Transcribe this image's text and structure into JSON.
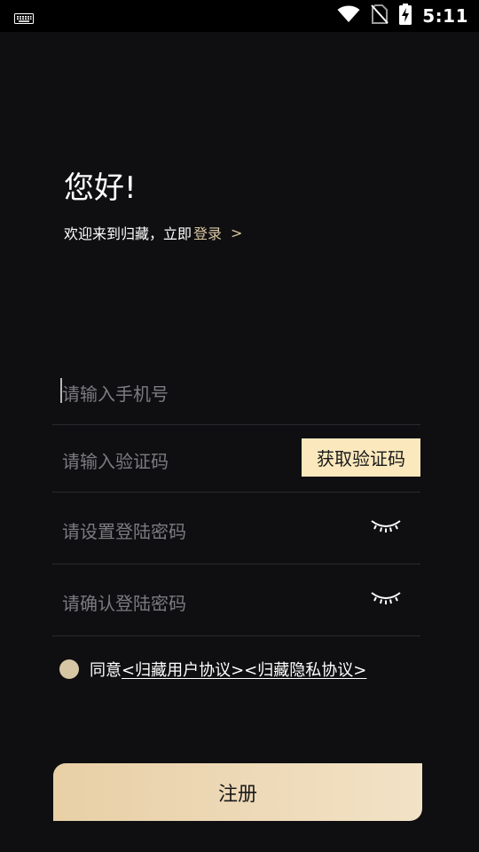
{
  "status_bar": {
    "time": "5:11",
    "icons": [
      "keyboard-icon",
      "wifi-icon",
      "no-sim-icon",
      "battery-charging-icon"
    ]
  },
  "header": {
    "greeting": "您好!",
    "welcome_text": "欢迎来到归藏，立即",
    "login_link": "登录",
    "login_chevron": ">"
  },
  "form": {
    "phone_placeholder": "请输入手机号",
    "code_placeholder": "请输入验证码",
    "get_code_label": "获取验证码",
    "password_placeholder": "请设置登陆密码",
    "confirm_password_placeholder": "请确认登陆密码"
  },
  "agreement": {
    "prefix": "同意",
    "user_agreement": "<归藏用户协议>",
    "privacy_agreement": "<归藏隐私协议>"
  },
  "register_label": "注册",
  "colors": {
    "background": "#0f0f11",
    "accent": "#d9c6a3",
    "get_code_bg": "#fbe9bd",
    "register_gradient_start": "#e8cfa6",
    "register_gradient_end": "#f2e2c6"
  }
}
